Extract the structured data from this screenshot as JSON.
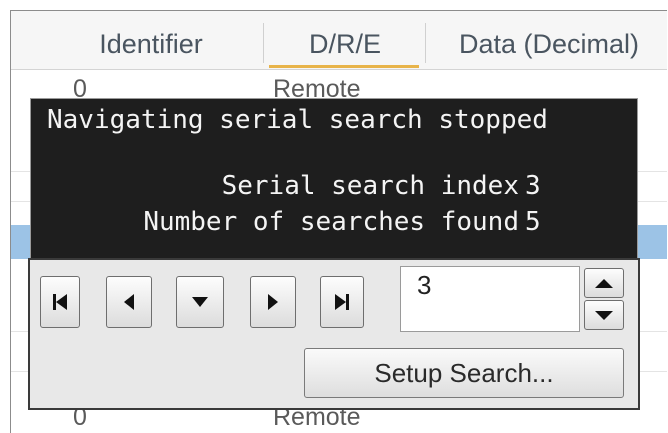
{
  "table": {
    "columns": [
      "Identifier",
      "D/R/E",
      "Data (Decimal)"
    ],
    "rows": [
      {
        "identifier": "0",
        "dre": "Remote"
      },
      {
        "identifier": "0",
        "dre": "Remote"
      }
    ]
  },
  "info": {
    "message": "Navigating serial search stopped",
    "index_label": "Serial search index",
    "index_value": "3",
    "found_label": "Number of searches found",
    "found_value": "5"
  },
  "nav": {
    "buttons": [
      {
        "name": "first-button",
        "icon": "first-icon"
      },
      {
        "name": "previous-button",
        "icon": "previous-icon"
      },
      {
        "name": "down-button",
        "icon": "down-icon"
      },
      {
        "name": "next-button",
        "icon": "next-icon"
      },
      {
        "name": "last-button",
        "icon": "last-icon"
      }
    ],
    "index_value": "3",
    "setup_label": "Setup Search..."
  },
  "colors": {
    "overlay": "#1e1e1e",
    "selection": "#9cc3e6",
    "sort_indicator": "#e8b44a"
  }
}
